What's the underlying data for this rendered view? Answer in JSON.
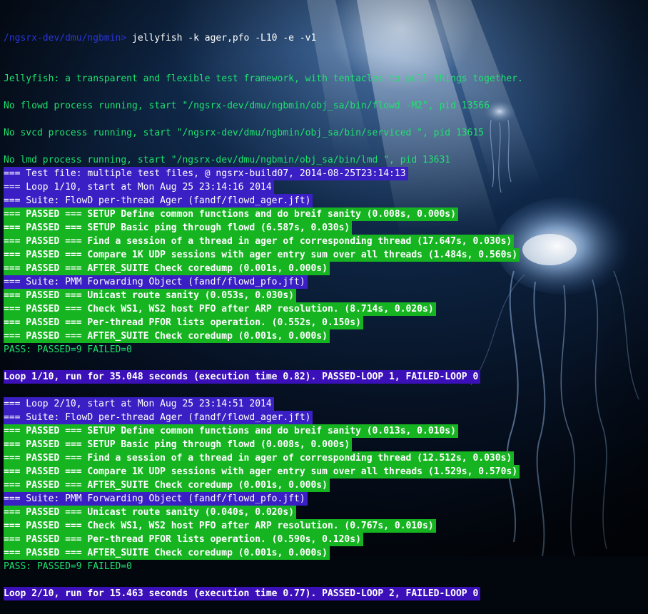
{
  "prompt": {
    "path": "/ngsrx-dev/dmu/ngbmin>",
    "command": " jellyfish -k ager,pfo -L10 -e -v1"
  },
  "lines": [
    {
      "kind": "text",
      "text": "Jellyfish: a transparent and flexible test framework, with tentacles to pull things together."
    },
    {
      "kind": "blank",
      "text": ""
    },
    {
      "kind": "text",
      "text": "No flowd process running, start \"/ngsrx-dev/dmu/ngbmin/obj_sa/bin/flowd -M2\", pid 13566"
    },
    {
      "kind": "blank",
      "text": ""
    },
    {
      "kind": "text",
      "text": "No svcd process running, start \"/ngsrx-dev/dmu/ngbmin/obj_sa/bin/serviced \", pid 13615"
    },
    {
      "kind": "blank",
      "text": ""
    },
    {
      "kind": "text",
      "text": "No lmd process running, start \"/ngsrx-dev/dmu/ngbmin/obj_sa/bin/lmd \", pid 13631"
    },
    {
      "kind": "hdr",
      "text": "=== Test file: multiple test files, @ ngsrx-build07, 2014-08-25T23:14:13"
    },
    {
      "kind": "hdr",
      "text": "=== Loop 1/10, start at Mon Aug 25 23:14:16 2014"
    },
    {
      "kind": "hdr",
      "text": "=== Suite: FlowD per-thread Ager (fandf/flowd_ager.jft)"
    },
    {
      "kind": "pass",
      "text": "=== PASSED === SETUP Define common functions and do breif sanity (0.008s, 0.000s)"
    },
    {
      "kind": "pass",
      "text": "=== PASSED === SETUP Basic ping through flowd (6.587s, 0.030s)"
    },
    {
      "kind": "pass",
      "text": "=== PASSED === Find a session of a thread in ager of corresponding thread (17.647s, 0.030s)"
    },
    {
      "kind": "pass",
      "text": "=== PASSED === Compare 1K UDP sessions with ager entry sum over all threads (1.484s, 0.560s)"
    },
    {
      "kind": "pass",
      "text": "=== PASSED === AFTER_SUITE Check coredump (0.001s, 0.000s)"
    },
    {
      "kind": "hdr",
      "text": "=== Suite: PMM Forwarding Object (fandf/flowd_pfo.jft)"
    },
    {
      "kind": "pass",
      "text": "=== PASSED === Unicast route sanity (0.053s, 0.030s)"
    },
    {
      "kind": "pass",
      "text": "=== PASSED === Check WS1, WS2 host PFO after ARP resolution. (8.714s, 0.020s)"
    },
    {
      "kind": "pass",
      "text": "=== PASSED === Per-thread PFOR lists operation. (0.552s, 0.150s)"
    },
    {
      "kind": "pass",
      "text": "=== PASSED === AFTER_SUITE Check coredump (0.001s, 0.000s)"
    },
    {
      "kind": "text",
      "text": "PASS: PASSED=9 FAILED=0"
    },
    {
      "kind": "blank",
      "text": ""
    },
    {
      "kind": "loop",
      "text": "Loop 1/10, run for 35.048 seconds (execution time 0.82). PASSED-LOOP 1, FAILED-LOOP 0"
    },
    {
      "kind": "blank",
      "text": ""
    },
    {
      "kind": "hdr",
      "text": "=== Loop 2/10, start at Mon Aug 25 23:14:51 2014"
    },
    {
      "kind": "hdr",
      "text": "=== Suite: FlowD per-thread Ager (fandf/flowd_ager.jft)"
    },
    {
      "kind": "pass",
      "text": "=== PASSED === SETUP Define common functions and do breif sanity (0.013s, 0.010s)"
    },
    {
      "kind": "pass",
      "text": "=== PASSED === SETUP Basic ping through flowd (0.008s, 0.000s)"
    },
    {
      "kind": "pass",
      "text": "=== PASSED === Find a session of a thread in ager of corresponding thread (12.512s, 0.030s)"
    },
    {
      "kind": "pass",
      "text": "=== PASSED === Compare 1K UDP sessions with ager entry sum over all threads (1.529s, 0.570s)"
    },
    {
      "kind": "pass",
      "text": "=== PASSED === AFTER_SUITE Check coredump (0.001s, 0.000s)"
    },
    {
      "kind": "hdr",
      "text": "=== Suite: PMM Forwarding Object (fandf/flowd_pfo.jft)"
    },
    {
      "kind": "pass",
      "text": "=== PASSED === Unicast route sanity (0.040s, 0.020s)"
    },
    {
      "kind": "pass",
      "text": "=== PASSED === Check WS1, WS2 host PFO after ARP resolution. (0.767s, 0.010s)"
    },
    {
      "kind": "pass",
      "text": "=== PASSED === Per-thread PFOR lists operation. (0.590s, 0.120s)"
    },
    {
      "kind": "pass",
      "text": "=== PASSED === AFTER_SUITE Check coredump (0.001s, 0.000s)"
    },
    {
      "kind": "text",
      "text": "PASS: PASSED=9 FAILED=0"
    },
    {
      "kind": "blank",
      "text": ""
    },
    {
      "kind": "loop",
      "text": "Loop 2/10, run for 15.463 seconds (execution time 0.77). PASSED-LOOP 2, FAILED-LOOP 0"
    }
  ],
  "colors": {
    "text": "#1ee36e",
    "header_bg": "#3a1fc4",
    "pass_bg": "#16b421",
    "loop_bg": "#3b10b8",
    "prompt_path": "#2a35d8"
  }
}
